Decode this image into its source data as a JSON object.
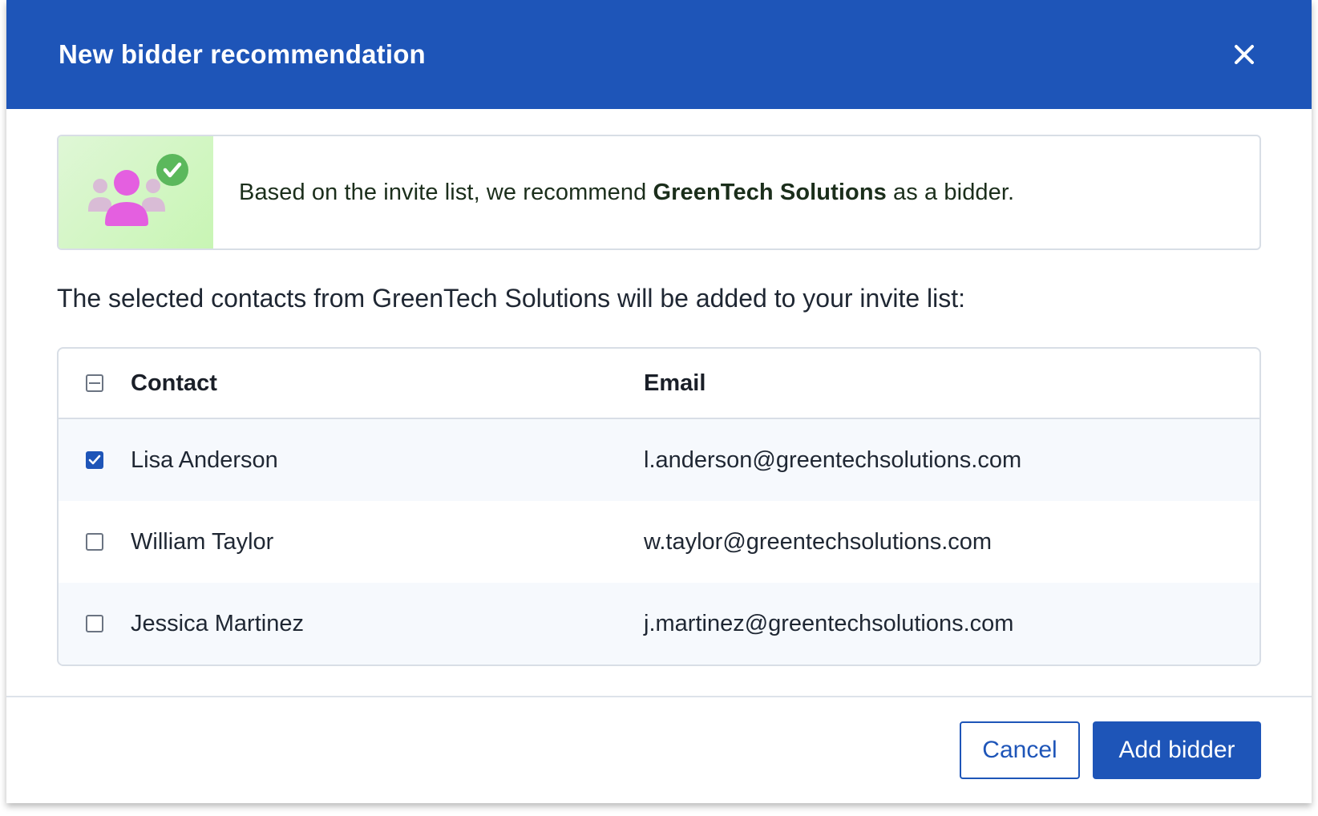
{
  "dialog": {
    "title": "New bidder recommendation"
  },
  "banner": {
    "text_before": "Based on the invite list, we recommend ",
    "company": "GreenTech Solutions",
    "text_after": " as a bidder.",
    "illustration_icon": "group-check-icon"
  },
  "intro_text": "The selected contacts from GreenTech Solutions will be added to your invite list:",
  "table": {
    "headers": {
      "contact": "Contact",
      "email": "Email"
    },
    "select_all_state": "indeterminate",
    "rows": [
      {
        "contact": "Lisa Anderson",
        "email": "l.anderson@greentechsolutions.com",
        "checked": true
      },
      {
        "contact": "William Taylor",
        "email": "w.taylor@greentechsolutions.com",
        "checked": false
      },
      {
        "contact": "Jessica Martinez",
        "email": "j.martinez@greentechsolutions.com",
        "checked": false
      }
    ]
  },
  "footer": {
    "cancel_label": "Cancel",
    "primary_label": "Add bidder"
  },
  "colors": {
    "primary": "#1e55b8",
    "banner_green": "#c8f5b4",
    "check_green": "#5bb85c",
    "person_pink": "#e45fe0",
    "person_muted": "#d9bcd6"
  }
}
